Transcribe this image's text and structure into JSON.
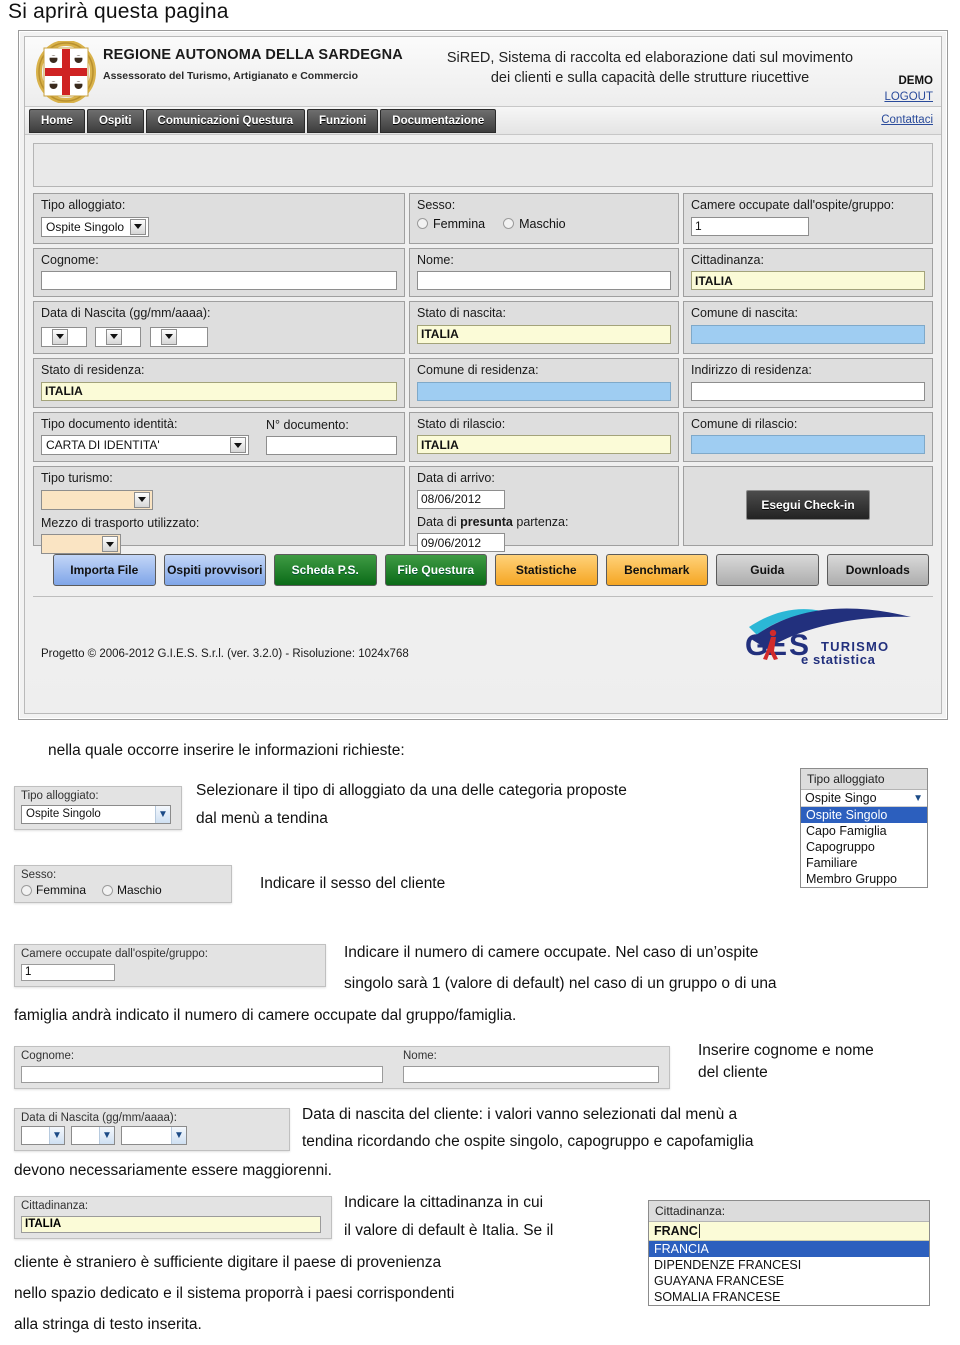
{
  "intro": {
    "text": "Si aprirà questa pagina"
  },
  "app": {
    "header": {
      "region_title": "REGIONE AUTONOMA DELLA SARDEGNA",
      "region_subtitle": "Assessorato del Turismo, Artigianato e Commercio",
      "system_title_line1": "SiRED, Sistema di raccolta ed elaborazione dati sul movimento",
      "system_title_line2": "dei clienti e sulla capacità delle strutture riucettive",
      "user_label": "DEMO",
      "logout_label": "LOGOUT",
      "crest_icon": "sardinia-coat-of-arms"
    },
    "nav": {
      "items": [
        {
          "label": "Home"
        },
        {
          "label": "Ospiti"
        },
        {
          "label": "Comunicazioni Questura"
        },
        {
          "label": "Funzioni"
        },
        {
          "label": "Documentazione"
        }
      ],
      "contact_label": "Contattaci"
    },
    "form": {
      "tipo_alloggiato_label": "Tipo alloggiato:",
      "tipo_alloggiato_value": "Ospite Singolo",
      "sesso_label": "Sesso:",
      "sesso_femmina": "Femmina",
      "sesso_maschio": "Maschio",
      "camere_label": "Camere occupate dall'ospite/gruppo:",
      "camere_value": "1",
      "cognome_label": "Cognome:",
      "cognome_value": "",
      "nome_label": "Nome:",
      "nome_value": "",
      "cittadinanza_label": "Cittadinanza:",
      "cittadinanza_value": "ITALIA",
      "data_nascita_label": "Data di Nascita (gg/mm/aaaa):",
      "stato_nascita_label": "Stato di nascita:",
      "stato_nascita_value": "ITALIA",
      "comune_nascita_label": "Comune di nascita:",
      "comune_nascita_value": "",
      "stato_residenza_label": "Stato di residenza:",
      "stato_residenza_value": "ITALIA",
      "comune_residenza_label": "Comune di residenza:",
      "comune_residenza_value": "",
      "indirizzo_residenza_label": "Indirizzo di residenza:",
      "indirizzo_residenza_value": "",
      "tipo_documento_label": "Tipo documento identità:",
      "tipo_documento_value": "CARTA DI IDENTITA'",
      "n_documento_label": "N° documento:",
      "n_documento_value": "",
      "stato_rilascio_label": "Stato di rilascio:",
      "stato_rilascio_value": "ITALIA",
      "comune_rilascio_label": "Comune di rilascio:",
      "comune_rilascio_value": "",
      "tipo_turismo_label": "Tipo turismo:",
      "tipo_turismo_value": "",
      "mezzo_trasporto_label": "Mezzo di trasporto utilizzato:",
      "mezzo_trasporto_value": "",
      "data_arrivo_label": "Data di arrivo:",
      "data_arrivo_value": "08/06/2012",
      "data_partenza_label_a": "Data di ",
      "data_partenza_label_b": "presunta",
      "data_partenza_label_c": " partenza:",
      "data_partenza_value": "09/06/2012",
      "checkin_button": "Esegui Check-in"
    },
    "actions": [
      {
        "label": "Importa File",
        "color": "blue"
      },
      {
        "label": "Ospiti provvisori",
        "color": "blue"
      },
      {
        "label": "Scheda P.S.",
        "color": "green"
      },
      {
        "label": "File Questura",
        "color": "green"
      },
      {
        "label": "Statistiche",
        "color": "amber"
      },
      {
        "label": "Benchmark",
        "color": "amber"
      },
      {
        "label": "Guida",
        "color": "grey"
      },
      {
        "label": "Downloads",
        "color": "grey"
      }
    ],
    "footer": {
      "copyright": "Progetto © 2006-2012 G.I.E.S. S.r.l. (ver. 3.2.0) - Risoluzione: 1024x768",
      "logo_name": "GIES",
      "logo_tag1": "TURISMO",
      "logo_tag2": "e statistica"
    }
  },
  "guide": {
    "lead": "nella quale occorre inserire le informazioni richieste:",
    "p_tipo_line1": "Selezionare il tipo di alloggiato da una delle categoria proposte",
    "p_tipo_line2": "dal menù a tendina",
    "p_sesso": "Indicare il sesso del cliente",
    "p_camere_line1": "Indicare il numero di camere occupate. Nel caso di un’ospite",
    "p_camere_line2": "singolo sarà 1 (valore di default) nel caso di un gruppo o di una",
    "p_camere_line3": "famiglia andrà indicato il numero di camere occupate dal gruppo/famiglia.",
    "p_nome_line1": "Inserire cognome e nome",
    "p_nome_line2": "del cliente",
    "p_nascita_line1": "Data di nascita del cliente: i valori vanno selezionati dal menù a",
    "p_nascita_line2": "tendina ricordando che ospite singolo, capogruppo e capofamiglia",
    "p_nascita_line3": "devono necessariamente essere maggiorenni.",
    "p_citt_line1": "Indicare la cittadinanza  in cui",
    "p_citt_line2": "il valore di default è Italia. Se il",
    "p_citt_line3": "cliente è straniero è sufficiente digitare il paese di provenienza",
    "p_citt_line4": "nello spazio dedicato e il sistema proporrà i paesi corrispondenti",
    "p_citt_line5": "alla stringa di testo inserita."
  },
  "snippets": {
    "tipo": {
      "label": "Tipo alloggiato:",
      "value": "Ospite Singolo"
    },
    "sesso": {
      "label": "Sesso:",
      "femmina": "Femmina",
      "maschio": "Maschio"
    },
    "camere": {
      "label": "Camere occupate dall'ospite/gruppo:",
      "value": "1"
    },
    "nomi": {
      "cognome_label": "Cognome:",
      "nome_label": "Nome:"
    },
    "nascita": {
      "label": "Data di Nascita (gg/mm/aaaa):"
    },
    "cittadinanza": {
      "label": "Cittadinanza:",
      "value": "ITALIA"
    }
  },
  "popups": {
    "tipo_alloggiato": {
      "header": "Tipo alloggiato",
      "closed_value": "Ospite Singo",
      "options": [
        {
          "label": "Ospite Singolo",
          "selected": true
        },
        {
          "label": "Capo Famiglia",
          "selected": false
        },
        {
          "label": "Capogruppo",
          "selected": false
        },
        {
          "label": "Familiare",
          "selected": false
        },
        {
          "label": "Membro Gruppo",
          "selected": false
        }
      ]
    },
    "cittadinanza": {
      "header": "Cittadinanza:",
      "typed_value": "FRANC",
      "options": [
        {
          "label": "FRANCIA",
          "selected": true
        },
        {
          "label": "DIPENDENZE FRANCESI",
          "selected": false
        },
        {
          "label": "GUAYANA FRANCESE",
          "selected": false
        },
        {
          "label": "SOMALIA FRANCESE",
          "selected": false
        }
      ]
    }
  },
  "colors": {
    "highlight_blue": "#2c5fbe",
    "field_yellow": "#fbfbd7",
    "field_blue": "#9fcdf2",
    "link_blue": "#2a4b9b"
  }
}
